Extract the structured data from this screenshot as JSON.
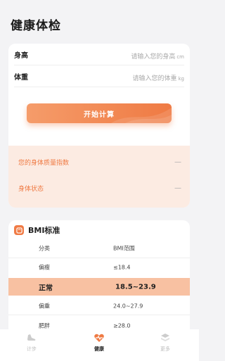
{
  "page": {
    "title": "健康体检"
  },
  "form": {
    "height": {
      "label": "身高",
      "placeholder": "请输入您的身高",
      "unit": "cm"
    },
    "weight": {
      "label": "体重",
      "placeholder": "请输入您的体重",
      "unit": "kg"
    },
    "start_button": "开始计算"
  },
  "result": {
    "bmi_label": "您的身体质量指数",
    "bmi_value": "—",
    "status_label": "身体状态",
    "status_value": "—"
  },
  "bmi_table": {
    "title": "BMI标准",
    "header": {
      "col1": "分类",
      "col2": "BMI范围"
    },
    "rows": [
      {
        "category": "偏瘦",
        "range": "≤18.4"
      },
      {
        "category": "正常",
        "range": "18.5~23.9"
      },
      {
        "category": "偏重",
        "range": "24.0~27.9"
      },
      {
        "category": "肥胖",
        "range": "≥28.0"
      }
    ]
  },
  "tabbar": {
    "tabs": [
      {
        "label": "计步",
        "icon": "shoe-icon"
      },
      {
        "label": "健康",
        "icon": "heart-pulse-icon"
      },
      {
        "label": "更多",
        "icon": "layers-icon"
      }
    ],
    "active": 1
  },
  "colors": {
    "accent": "#ef7a43",
    "highlight": "#f8c1a2",
    "result_bg": "#fcebe2"
  }
}
